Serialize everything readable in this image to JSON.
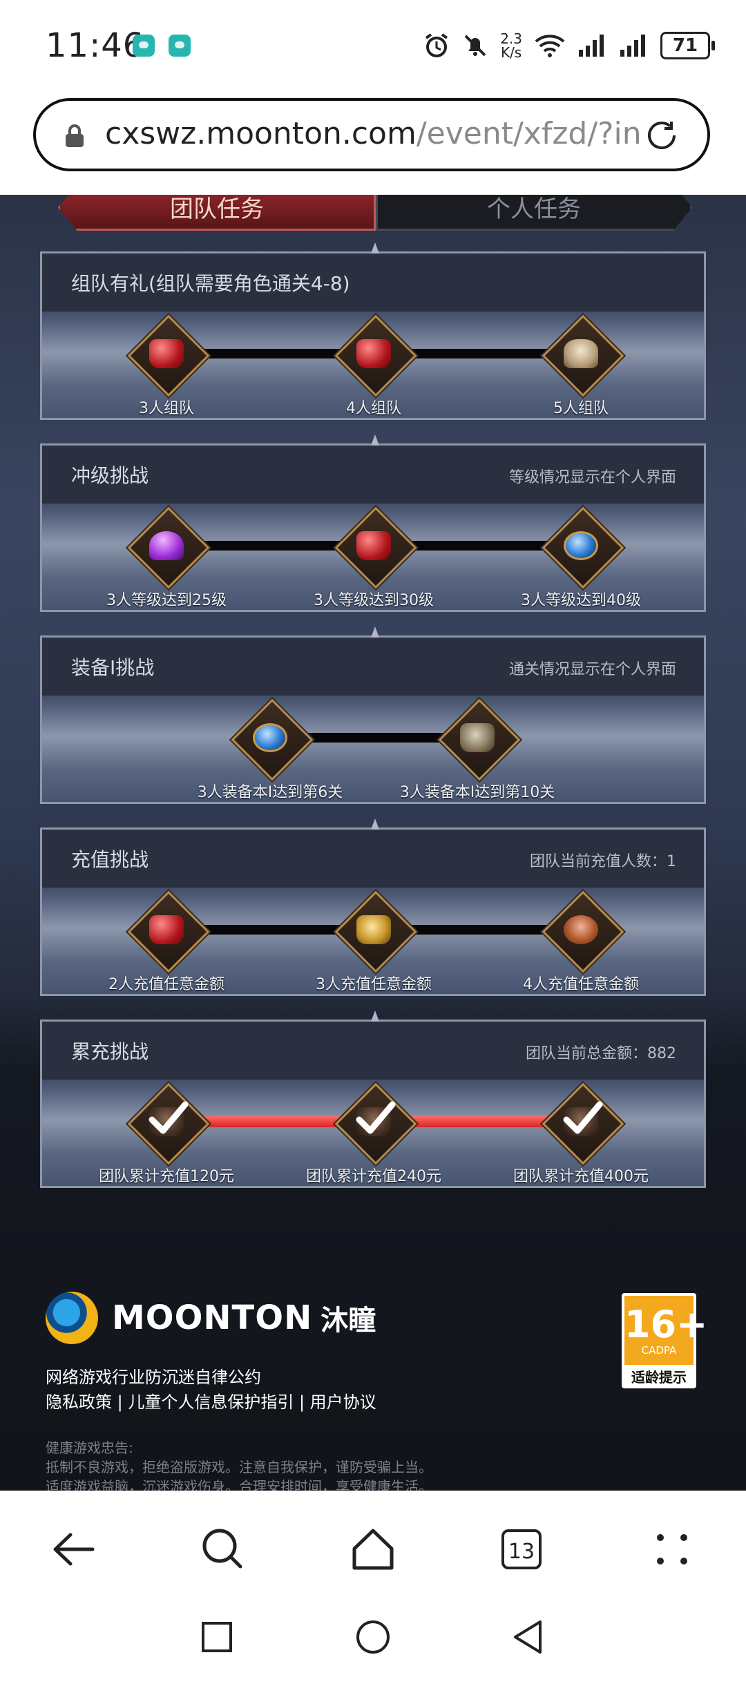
{
  "status_bar": {
    "time": "11:46",
    "net_speed_value": "2.3",
    "net_speed_unit": "K/s",
    "battery": "71"
  },
  "url_bar": {
    "host": "cxswz.moonton.com",
    "path": "/event/xfzd/?in"
  },
  "tabs": {
    "team": "团队任务",
    "personal": "个人任务"
  },
  "cards": [
    {
      "title": "组队有礼(组队需要角色通关4-8)",
      "note": "",
      "rewards": [
        {
          "label": "3人组队",
          "icon": "red-gem-icon"
        },
        {
          "label": "4人组队",
          "icon": "red-gem-icon"
        },
        {
          "label": "5人组队",
          "icon": "armor-icon"
        }
      ]
    },
    {
      "title": "冲级挑战",
      "note": "等级情况显示在个人界面",
      "rewards": [
        {
          "label": "3人等级达到25级",
          "icon": "purple-crystal-icon"
        },
        {
          "label": "3人等级达到30级",
          "icon": "red-gem-icon"
        },
        {
          "label": "3人等级达到40级",
          "icon": "blue-amulet-icon"
        }
      ]
    },
    {
      "title": "装备I挑战",
      "note": "通关情况显示在个人界面",
      "rewards": [
        {
          "label": "3人装备本I达到第6关",
          "icon": "blue-amulet-icon"
        },
        {
          "label": "3人装备本I达到第10关",
          "icon": "item-bag-icon"
        }
      ]
    },
    {
      "title": "充值挑战",
      "note": "团队当前充值人数：1",
      "rewards": [
        {
          "label": "2人充值任意金额",
          "icon": "red-gem-icon"
        },
        {
          "label": "3人充值任意金额",
          "icon": "gold-relic-icon"
        },
        {
          "label": "4人充值任意金额",
          "icon": "food-icon"
        }
      ]
    },
    {
      "title": "累充挑战",
      "note": "团队当前总金额：882",
      "rewards": [
        {
          "label": "团队累计充值120元",
          "icon": "checked-reward-icon"
        },
        {
          "label": "团队累计充值240元",
          "icon": "checked-reward-icon"
        },
        {
          "label": "团队累计充值400元",
          "icon": "checked-reward-icon"
        }
      ]
    }
  ],
  "footer": {
    "logo_text": "MOONTON",
    "logo_cn": "沐瞳",
    "age_rating": "16+",
    "age_sub": "CADPA",
    "age_hint": "适龄提示",
    "line1": "网络游戏行业防沉迷自律公约",
    "line2": "隐私政策 | 儿童个人信息保护指引 | 用户协议",
    "health_title": "健康游戏忠告:",
    "health_1": "抵制不良游戏，拒绝盗版游戏。注意自我保护，谨防受骗上当。",
    "health_2": "适度游戏益脑，沉迷游戏伤身。合理安排时间，享受健康生活。"
  },
  "browser_nav": {
    "tab_count": "13"
  }
}
